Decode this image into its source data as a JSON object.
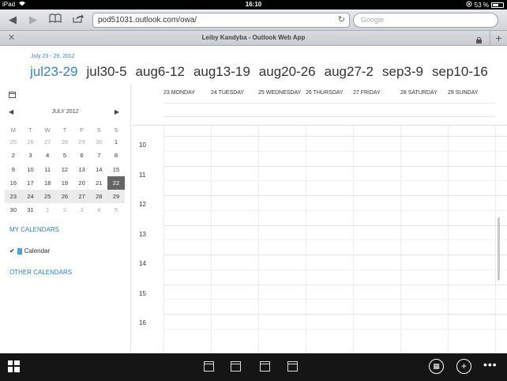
{
  "status_bar": {
    "device": "iPad",
    "time": "16:10",
    "battery": "53 %"
  },
  "browser": {
    "url": "pod51031.outlook.com/owa/",
    "search_placeholder": "Google",
    "tab_title": "Leiby Kandyba - Outlook Web App"
  },
  "calendar": {
    "range_label": "July 23 - 29, 2012",
    "weeks": [
      "jul23-29",
      "jul30-5",
      "aug6-12",
      "aug13-19",
      "aug20-26",
      "aug27-2",
      "sep3-9",
      "sep10-16"
    ],
    "active_week_index": 0,
    "day_headers": [
      "23 MONDAY",
      "24 TUESDAY",
      "25 WEDNESDAY",
      "26 THURSDAY",
      "27 FRIDAY",
      "28 SATURDAY",
      "29 SUNDAY"
    ],
    "hours": [
      "10",
      "11",
      "12",
      "13",
      "14",
      "15",
      "16"
    ]
  },
  "mini_calendar": {
    "month_label": "JULY 2012",
    "dow": [
      "M",
      "T",
      "W",
      "T",
      "F",
      "S",
      "S"
    ],
    "weeks": [
      [
        "25",
        "26",
        "27",
        "28",
        "29",
        "30",
        "1"
      ],
      [
        "2",
        "3",
        "4",
        "5",
        "6",
        "7",
        "8"
      ],
      [
        "9",
        "10",
        "11",
        "12",
        "13",
        "14",
        "15"
      ],
      [
        "16",
        "17",
        "18",
        "19",
        "20",
        "21",
        "22"
      ],
      [
        "23",
        "24",
        "25",
        "26",
        "27",
        "28",
        "29"
      ],
      [
        "30",
        "31",
        "1",
        "2",
        "3",
        "4",
        "5"
      ]
    ],
    "today": "22"
  },
  "sidebar": {
    "my_calendars": "MY CALENDARS",
    "calendar_name": "Calendar",
    "calendar_checked": true,
    "other_calendars": "OTHER CALENDARS",
    "calendar_color": "#4aa3df"
  },
  "colors": {
    "accent": "#2d89c8",
    "today_bg": "#666666"
  }
}
